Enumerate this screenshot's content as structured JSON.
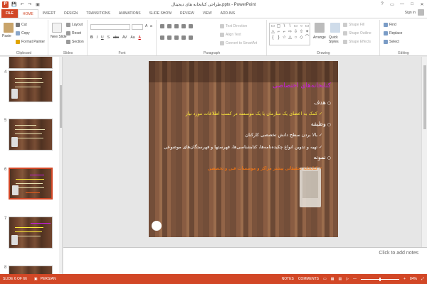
{
  "window": {
    "title": "طراحی کتابخانه های دیجیتال.pptx - PowerPoint",
    "controls": [
      "?",
      "▭",
      "—",
      "□",
      "✕"
    ]
  },
  "qat": [
    "💾",
    "↶",
    "↷",
    "▣"
  ],
  "tabs": [
    "FILE",
    "HOME",
    "INSERT",
    "DESIGN",
    "TRANSITIONS",
    "ANIMATIONS",
    "SLIDE SHOW",
    "REVIEW",
    "VIEW",
    "ADD-INS"
  ],
  "signin": "Sign in",
  "ribbon": {
    "clipboard": {
      "paste": "Paste",
      "cut": "Cut",
      "copy": "Copy",
      "format_painter": "Format Painter",
      "label": "Clipboard"
    },
    "slides": {
      "new_slide": "New Slide",
      "layout": "Layout",
      "reset": "Reset",
      "section": "Section",
      "label": "Slides"
    },
    "font": {
      "label": "Font",
      "buttons": [
        "B",
        "I",
        "U",
        "S",
        "abc",
        "AV",
        "Aa",
        "A"
      ]
    },
    "paragraph": {
      "label": "Paragraph",
      "text_direction": "Text Direction",
      "align_text": "Align Text",
      "convert": "Convert to SmartArt"
    },
    "drawing": {
      "label": "Drawing",
      "arrange": "Arrange",
      "quick_styles": "Quick Styles",
      "shape_fill": "Shape Fill",
      "shape_outline": "Shape Outline",
      "shape_effects": "Shape Effects",
      "shapes": [
        "▭",
        "▢",
        "\\",
        "\\",
        "▭",
        "○",
        "▭",
        "△",
        "⌐",
        "⌐",
        "⇨",
        "⇩",
        "⇧",
        "✦",
        "{",
        "}",
        "☆",
        "△",
        "○",
        "◇",
        "⌒"
      ]
    },
    "editing": {
      "label": "Editing",
      "find": "Find",
      "replace": "Replace",
      "select": "Select"
    }
  },
  "thumbnails": [
    {
      "num": "4"
    },
    {
      "num": "5"
    },
    {
      "num": "6",
      "selected": true
    },
    {
      "num": "7"
    },
    {
      "num": "8"
    }
  ],
  "slide": {
    "title": "کتابخانه‌های اختصاصی",
    "heading1": "هدف",
    "item1": "کمک به اعضای یک سازمان یا یک موسسه در کسب اطلاعات مورد نیاز",
    "heading2": "وظیفه",
    "item2": "بالا بردن سطح دانش تخصصی کارکنان",
    "item3": "تهیه و تدوین انواع چکیده‌نامه‌ها، کتابشناسی‌ها، فهرستها و فهرستگان‌های موضوعی",
    "heading3": "نمونه",
    "item4": "کتابخانه تحقیقاتی بیشتر مراکز و موسسات فنی و تخصصی"
  },
  "notes_placeholder": "Click to add notes",
  "status": {
    "slide": "SLIDE 6 OF 66",
    "language": "PERSIAN",
    "notes": "NOTES",
    "comments": "COMMENTS",
    "zoom": "84%"
  },
  "colors": {
    "accent": "#d24726",
    "slide_title": "#c81de0",
    "highlight_yellow": "#ffef3a",
    "highlight_orange": "#ff7a10"
  }
}
